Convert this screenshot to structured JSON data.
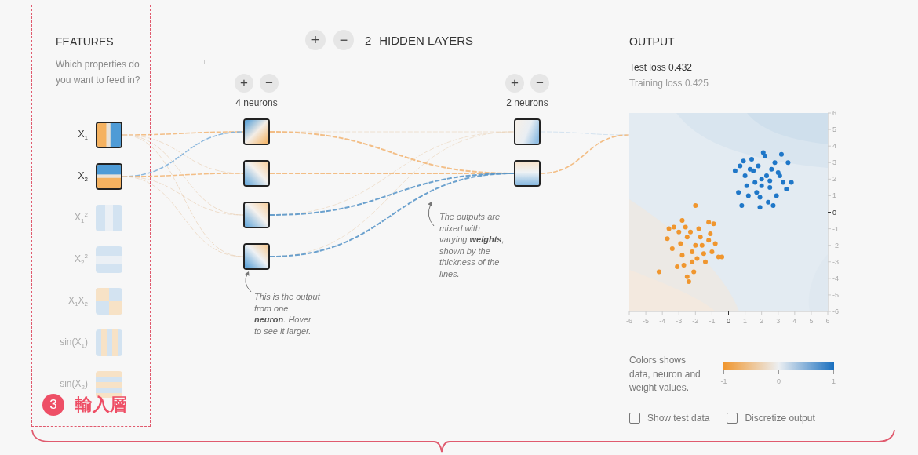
{
  "features": {
    "title": "FEATURES",
    "description": "Which properties do you want to feed in?",
    "items": [
      {
        "label": "X$_{1}$",
        "kind": "split-x",
        "active": true
      },
      {
        "label": "X$_{2}$",
        "kind": "split-y",
        "active": true
      },
      {
        "label": "X$_{1}$$^{2}$",
        "kind": "bands-x",
        "active": false
      },
      {
        "label": "X$_{2}$$^{2}$",
        "kind": "bands-y",
        "active": false
      },
      {
        "label": "X$_{1}$X$_{2}$",
        "kind": "quadrants",
        "active": false
      },
      {
        "label": "sin(X$_{1}$)",
        "kind": "stripes-x",
        "active": false
      },
      {
        "label": "sin(X$_{2}$)",
        "kind": "stripes-y",
        "active": false
      }
    ]
  },
  "hidden_layers": {
    "add": "+",
    "remove": "−",
    "count": "2",
    "title": "HIDDEN LAYERS",
    "layers": [
      {
        "add": "+",
        "remove": "−",
        "caption": "4 neurons",
        "nodes": [
          {
            "kind": "blue-to-orange"
          },
          {
            "kind": "orange-to-blue"
          },
          {
            "kind": "orange-to-blue"
          },
          {
            "kind": "blue-left"
          }
        ]
      },
      {
        "add": "+",
        "remove": "−",
        "caption": "2 neurons",
        "nodes": [
          {
            "kind": "pale-blue"
          },
          {
            "kind": "orange-top"
          }
        ]
      }
    ]
  },
  "callouts": [
    {
      "text": "This is the output\nfrom one\n**neuron**. Hover\nto see it larger."
    },
    {
      "text": "The outputs are\nmixed with\nvarying **weights**,\nshown by the\nthickness of the\nlines."
    }
  ],
  "output": {
    "title": "OUTPUT",
    "test_loss": "Test loss 0.432",
    "training_loss": "Training loss 0.425",
    "chart_data": {
      "type": "scatter",
      "xlim": [
        -6,
        6
      ],
      "ylim": [
        -6,
        6
      ],
      "xticks": [
        -6,
        -5,
        -4,
        -3,
        -2,
        -1,
        0,
        1,
        2,
        3,
        4,
        5,
        6
      ],
      "yticks": [
        -6,
        -5,
        -4,
        -3,
        -2,
        -1,
        0,
        1,
        2,
        3,
        4,
        5,
        6
      ],
      "x": [
        2,
        1.5,
        2.5,
        1,
        3,
        2.2,
        1.7,
        2.8,
        0.7,
        3.6,
        1.2,
        2.4,
        1.9,
        3.3,
        0.4,
        1.4,
        2.6,
        2,
        1.6,
        2.9,
        3.8,
        0.6,
        2.3,
        1.8,
        3.1,
        1.1,
        2.7,
        2.1,
        0.9,
        3.5,
        1.9,
        2.5,
        1.3,
        3.2,
        0.8,
        -2,
        -2.5,
        -1.5,
        -3,
        -2.2,
        -1.2,
        -3.4,
        -2.8,
        -1.8,
        -2.6,
        -1,
        -0.8,
        -3.6,
        -2.4,
        -2,
        -1.2,
        -0.9,
        -4.2,
        -3.1,
        -2.1,
        -1.6,
        -2.9,
        -2.3,
        -1.4,
        -0.6,
        -3.3,
        -1.9,
        -2.7,
        -1.1,
        -2.2,
        -3.7,
        -0.4,
        -2.5,
        -1.7,
        -2.8
      ],
      "series": [
        {
          "color": "#1f77c8",
          "values": [
            2,
            2.5,
            1.5,
            2.2,
            2.4,
            3.4,
            1.2,
            3,
            2.8,
            3,
            1,
            0.6,
            0.3,
            1.8,
            2.5,
            3.2,
            2.6,
            1.6,
            1.8,
            1,
            1.8,
            1.2,
            2.2,
            2.8,
            2.2,
            1.6,
            0.4,
            3.6,
            3.1,
            1.4,
            0.9,
            1.9,
            2.6,
            3.5,
            0.4,
            null,
            null,
            null,
            null,
            null,
            null,
            null,
            null,
            null,
            null,
            null,
            null,
            null,
            null,
            null,
            null,
            null,
            null,
            null,
            null,
            null,
            null,
            null,
            null,
            null,
            null,
            null,
            null,
            null,
            null,
            null,
            null,
            null,
            null,
            null
          ]
        },
        {
          "color": "#f0962e",
          "values": [
            null,
            null,
            null,
            null,
            null,
            null,
            null,
            null,
            null,
            null,
            null,
            null,
            null,
            null,
            null,
            null,
            null,
            null,
            null,
            null,
            null,
            null,
            null,
            null,
            null,
            null,
            null,
            null,
            null,
            null,
            null,
            null,
            null,
            null,
            null,
            -2,
            -1.5,
            -2.5,
            -1.2,
            -3,
            -1.7,
            -2.2,
            -2.6,
            -1,
            -0.9,
            -2.4,
            -1.9,
            -1,
            -4.2,
            0.4,
            -0.6,
            -0.7,
            -3.6,
            -3.3,
            -3.6,
            -2,
            -1.9,
            -1.2,
            -3,
            -2.7,
            -0.9,
            -2.8,
            -3.2,
            -1.3,
            -2.4,
            -1.6,
            -2.7,
            -3.9,
            -1.5,
            -0.5
          ]
        }
      ]
    },
    "legend": {
      "text": "Colors shows data, neuron and weight values.",
      "ticks": [
        "-1",
        "0",
        "1"
      ]
    },
    "checkboxes": [
      {
        "label": "Show test data",
        "checked": false
      },
      {
        "label": "Discretize output",
        "checked": false
      }
    ]
  },
  "annotation": {
    "number": "3",
    "label": "輸入層"
  }
}
